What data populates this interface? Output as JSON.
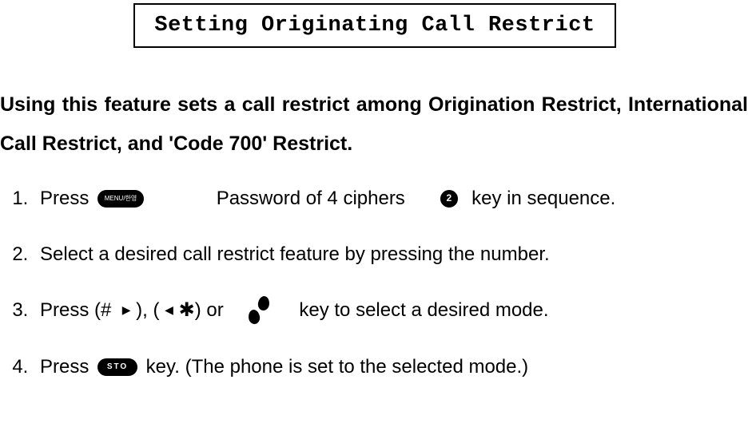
{
  "title": "Setting Originating Call Restrict",
  "intro": {
    "text": "Using this feature sets a call restrict among Origination Restrict, International Call Restrict, and 'Code 700' Restrict."
  },
  "icons": {
    "menu_label": "MENU/한영",
    "sto_label": "STO",
    "circle2": "2"
  },
  "steps": {
    "s1": {
      "t1": "Press ",
      "t2": "             Password of 4 ciphers      ",
      "t3": "  key in sequence."
    },
    "s2": {
      "t1": "Select a desired call restrict feature by pressing the number."
    },
    "s3": {
      "t1": "Press (#  ",
      "t2": " ), ( ",
      "t3": " ✱) or   ",
      "t4": "    key to select a desired mode."
    },
    "s4": {
      "t1": "Press ",
      "t2": " key. (The phone is set to the selected mode.)"
    }
  }
}
